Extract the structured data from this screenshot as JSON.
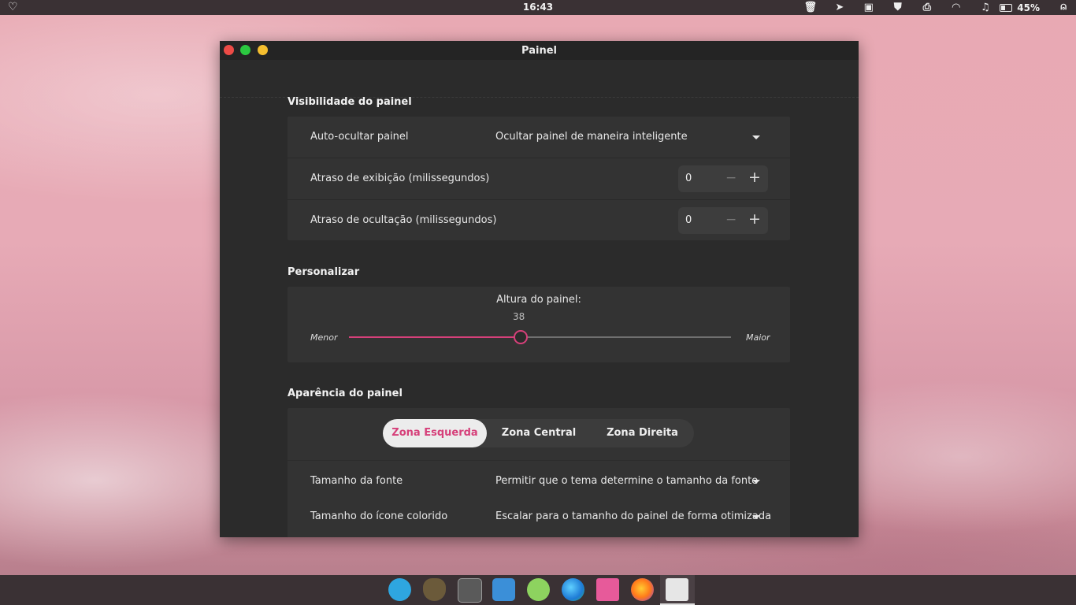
{
  "topbar": {
    "clock": "16:43",
    "battery": "45%",
    "tray_icons": [
      "trash-icon",
      "telegram-icon",
      "clipboard-icon",
      "shield-icon",
      "printer-icon",
      "wifi-icon",
      "music-icon",
      "battery-icon",
      "person-icon"
    ]
  },
  "window": {
    "title": "Painel",
    "sections": {
      "visibility": {
        "title": "Visibilidade do painel",
        "autohide_label": "Auto-ocultar painel",
        "autohide_value": "Ocultar painel de maneira inteligente",
        "show_delay_label": "Atraso de exibição (milissegundos)",
        "show_delay_value": "0",
        "hide_delay_label": "Atraso de ocultação (milissegundos)",
        "hide_delay_value": "0"
      },
      "customize": {
        "title": "Personalizar",
        "height_label": "Altura do painel:",
        "height_value": "38",
        "height_fraction": 0.45,
        "min_label": "Menor",
        "max_label": "Maior"
      },
      "appearance": {
        "title": "Aparência do painel",
        "tabs": [
          "Zona Esquerda",
          "Zona Central",
          "Zona Direita"
        ],
        "active_tab": 0,
        "font_size_label": "Tamanho da fonte",
        "font_size_value": "Permitir que o tema determine o tamanho da fonte",
        "icon_size_label": "Tamanho do ícone colorido",
        "icon_size_value": "Escalar para o tamanho do painel de forma otimizada"
      }
    }
  },
  "dock": {
    "apps": [
      "telegram-icon",
      "gimp-icon",
      "terminal-icon",
      "text-editor-icon",
      "atom-icon",
      "edge-beta-icon",
      "files-icon",
      "firefox-icon",
      "settings-icon"
    ],
    "active_app": "settings-icon"
  },
  "colors": {
    "accent": "#d6407a",
    "window_bg": "#2b2b2b",
    "card_bg": "#333333",
    "bar_bg": "#3a3134"
  }
}
